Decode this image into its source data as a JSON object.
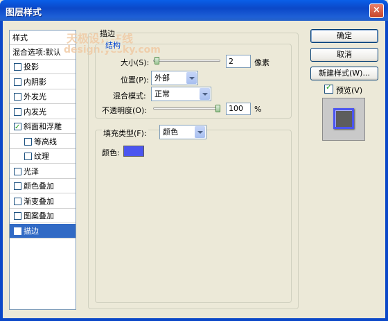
{
  "window": {
    "title": "图层样式",
    "close_glyph": "×"
  },
  "watermark": {
    "line1": "天极设计在线",
    "line2": "design.yesky.com"
  },
  "style_list": {
    "header": "样式",
    "blending": "混合选项:默认",
    "items": [
      {
        "label": "投影",
        "checked": false,
        "indent": false,
        "selected": false
      },
      {
        "label": "内阴影",
        "checked": false,
        "indent": false,
        "selected": false
      },
      {
        "label": "外发光",
        "checked": false,
        "indent": false,
        "selected": false
      },
      {
        "label": "内发光",
        "checked": false,
        "indent": false,
        "selected": false
      },
      {
        "label": "斜面和浮雕",
        "checked": true,
        "indent": false,
        "selected": false
      },
      {
        "label": "等高线",
        "checked": false,
        "indent": true,
        "selected": false
      },
      {
        "label": "纹理",
        "checked": false,
        "indent": true,
        "selected": false
      },
      {
        "label": "光泽",
        "checked": false,
        "indent": false,
        "selected": false
      },
      {
        "label": "颜色叠加",
        "checked": false,
        "indent": false,
        "selected": false
      },
      {
        "label": "渐变叠加",
        "checked": false,
        "indent": false,
        "selected": false
      },
      {
        "label": "图案叠加",
        "checked": false,
        "indent": false,
        "selected": false
      },
      {
        "label": "描边",
        "checked": true,
        "indent": false,
        "selected": true
      }
    ]
  },
  "stroke": {
    "group_title": "描边",
    "structure_title": "结构",
    "size": {
      "label": "大小(S):",
      "value": "2",
      "unit": "像素",
      "level": 0.02
    },
    "position": {
      "label": "位置(P):",
      "value": "外部"
    },
    "blend_mode": {
      "label": "混合模式:",
      "value": "正常"
    },
    "opacity": {
      "label": "不透明度(O):",
      "value": "100",
      "unit": "%",
      "level": 1.0
    },
    "fill_type": {
      "label": "填充类型(F):",
      "value": "颜色"
    },
    "color": {
      "label": "颜色:",
      "value": "#4b55f0"
    }
  },
  "buttons": {
    "ok": "确定",
    "cancel": "取消",
    "new_style": "新建样式(W)..."
  },
  "preview": {
    "label": "预览(V)",
    "checked": true
  },
  "colors": {
    "titlebar": "#0b48c8",
    "selection": "#316ac5",
    "stroke_color": "#4b55f0"
  }
}
